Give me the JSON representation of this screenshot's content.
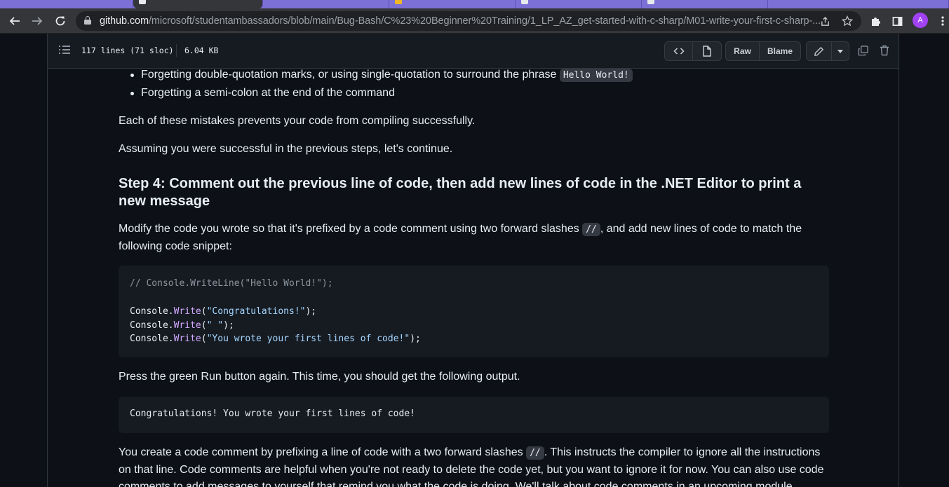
{
  "browser": {
    "url_domain": "github.com",
    "url_path": "/microsoft/studentambassadors/blob/main/Bug-Bash/C%23%20Beginner%20Training/1_LP_AZ_get-started-with-c-sharp/M01-write-your-first-c-sharp-...",
    "avatar_letter": "A",
    "accent_color": "#a142f4"
  },
  "file_header": {
    "lines": "117 lines (71 sloc)",
    "size": "6.04 KB",
    "raw_label": "Raw",
    "blame_label": "Blame"
  },
  "content": {
    "bullet1_text": "Forgetting double-quotation marks, or using single-quotation to surround the phrase ",
    "bullet1_code": "Hello World!",
    "bullet2_text": "Forgetting a semi-colon at the end of the command",
    "para1": "Each of these mistakes prevents your code from compiling successfully.",
    "para2": "Assuming you were successful in the previous steps, let's continue.",
    "heading": "Step 4: Comment out the previous line of code, then add new lines of code in the .NET Editor to print a new message",
    "para3_a": "Modify the code you wrote so that it's prefixed by a code comment using two forward slashes ",
    "para3_code": "//",
    "para3_b": ", and add new lines of code to match the",
    "para3_c": "following code snippet:",
    "code1": {
      "comment_line": "// Console.WriteLine(\"Hello World!\");",
      "line2_obj": "Console.",
      "line2_fn": "Write",
      "line2_str": "\"Congratulations!\"",
      "line3_obj": "Console.",
      "line3_fn": "Write",
      "line3_str": "\" \"",
      "line4_obj": "Console.",
      "line4_fn": "Write",
      "line4_str": "\"You wrote your first lines of code!\"",
      "open_paren": "(",
      "close": ");"
    },
    "para4": "Press the green Run button again. This time, you should get the following output.",
    "output": "Congratulations! You wrote your first lines of code!",
    "para5_a": "You create a code comment by prefixing a line of code with a two forward slashes ",
    "para5_code": "//",
    "para5_b": ". This instructs the compiler to ignore all the instructions",
    "para5_line2": "on that line. Code comments are helpful when you're not ready to delete the code yet, but you want to ignore it for now. You can also use code",
    "para5_line3": "comments to add messages to yourself that remind you what the code is doing. We'll talk about code comments in an upcoming module."
  }
}
